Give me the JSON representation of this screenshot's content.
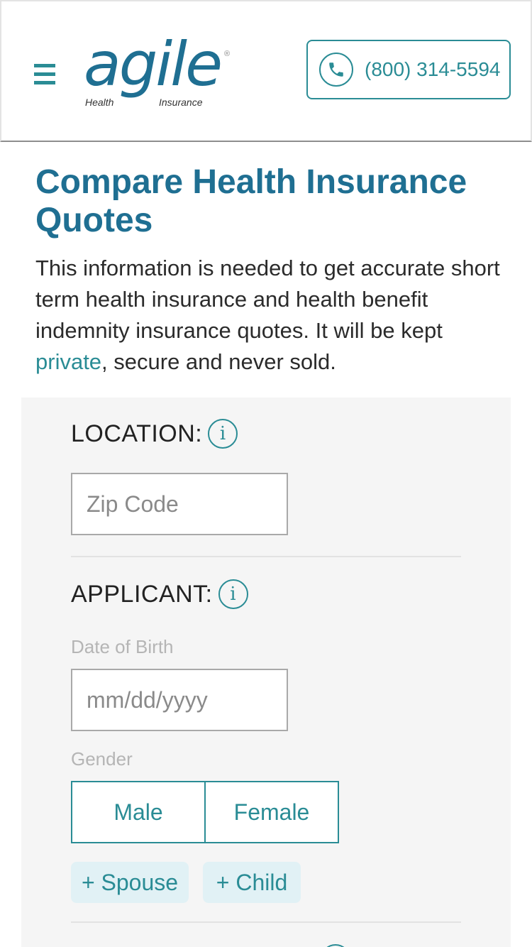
{
  "header": {
    "logo": {
      "word": "agile",
      "left_text": "Health",
      "right_text": "Insurance",
      "registered": "®"
    },
    "phone": "(800) 314-5594"
  },
  "page": {
    "title": "Compare Health Insurance Quotes",
    "intro_before": "This information is needed to get accurate short term health insurance and health benefit indemnity insurance quotes. It will be kept ",
    "intro_link": "private",
    "intro_after": ", secure and never sold."
  },
  "form": {
    "location": {
      "label": "LOCATION:",
      "zip_placeholder": "Zip Code"
    },
    "applicant": {
      "label": "APPLICANT:",
      "dob_label": "Date of Birth",
      "dob_placeholder": "mm/dd/yyyy",
      "gender_label": "Gender",
      "gender_options": [
        "Male",
        "Female"
      ],
      "add_spouse": "+ Spouse",
      "add_child": "+ Child"
    },
    "info_icon_glyph": "i"
  },
  "colors": {
    "primary": "#1f6f92",
    "accent": "#2a8c95",
    "panel_bg": "#f5f5f5",
    "chip_bg": "#e1f1f5"
  },
  "icons": {
    "menu": "hamburger-icon",
    "phone": "phone-icon",
    "info": "info-icon"
  }
}
